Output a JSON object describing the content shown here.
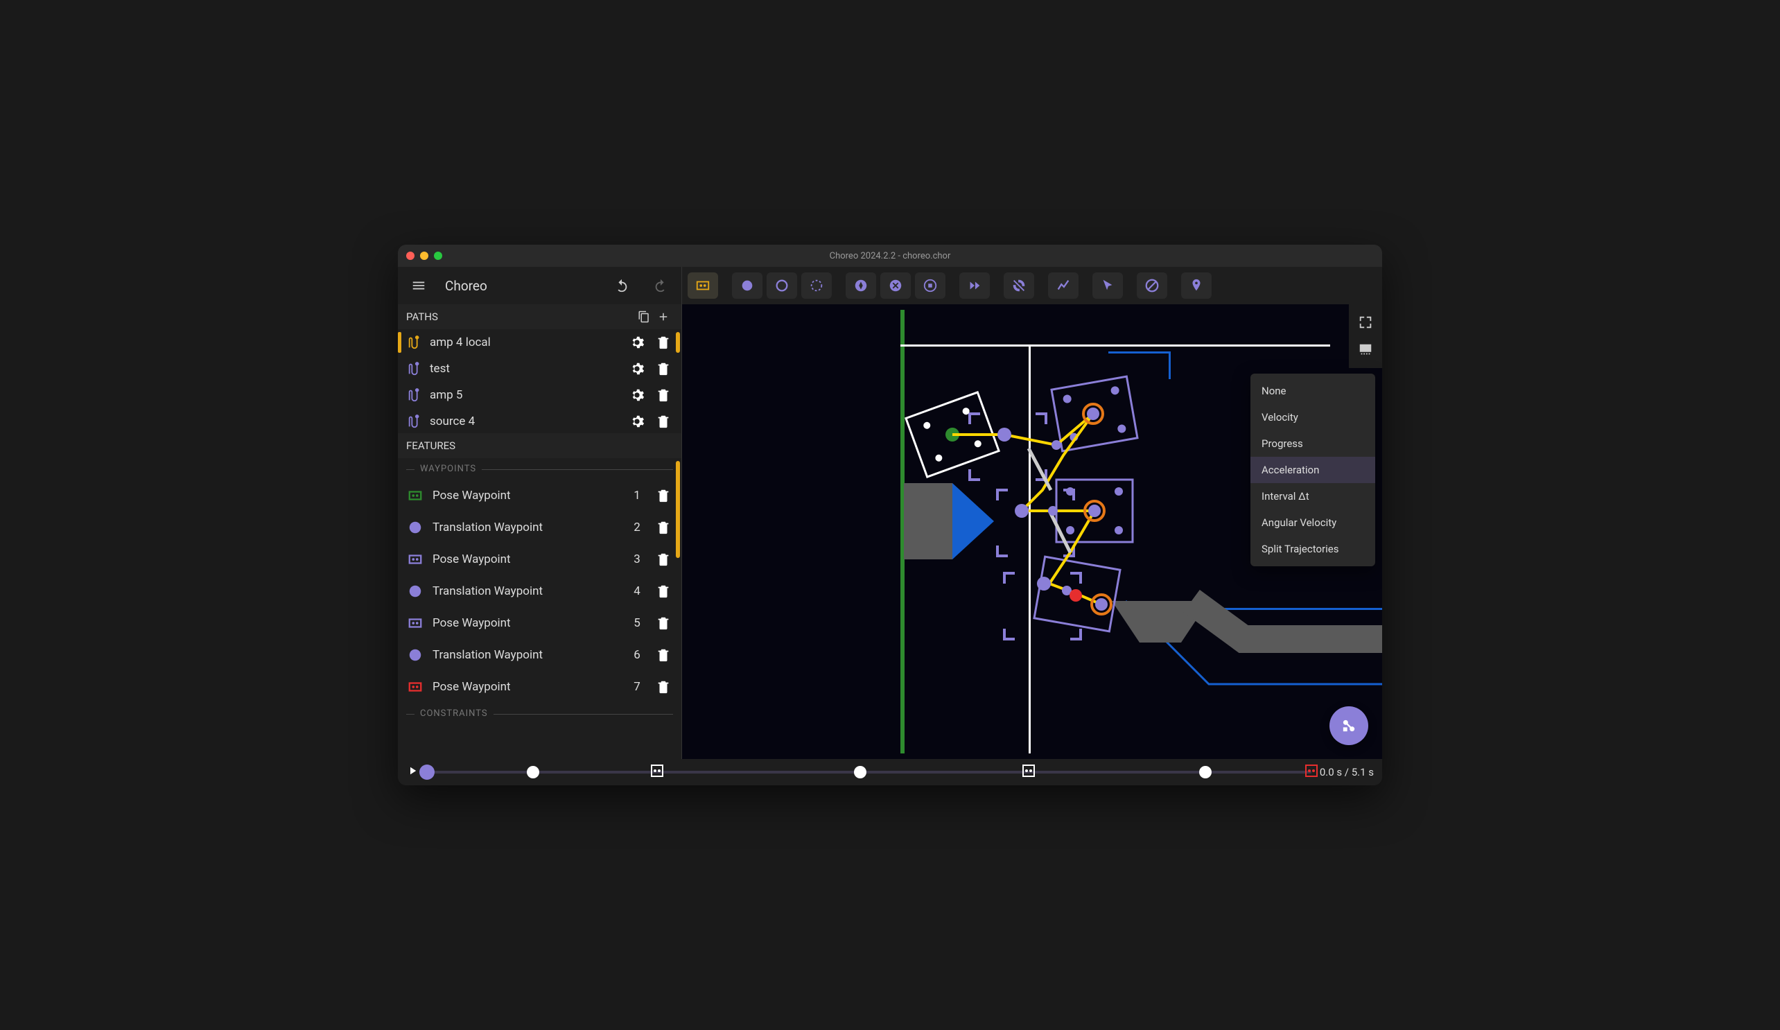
{
  "window_title": "Choreo 2024.2.2 - choreo.chor",
  "brand": "Choreo",
  "sections": {
    "paths": "PATHS",
    "features": "FEATURES",
    "waypoints": "WAYPOINTS",
    "constraints": "CONSTRAINTS"
  },
  "paths": [
    {
      "name": "amp 4 local",
      "selected": true,
      "color": "#e6a817"
    },
    {
      "name": "test",
      "selected": false,
      "color": "#8b7fd8"
    },
    {
      "name": "amp 5",
      "selected": false,
      "color": "#8b7fd8"
    },
    {
      "name": "source 4",
      "selected": false,
      "color": "#8b7fd8"
    }
  ],
  "waypoints": [
    {
      "label": "Pose Waypoint",
      "num": "1",
      "type": "pose",
      "color": "#2e8b2e"
    },
    {
      "label": "Translation Waypoint",
      "num": "2",
      "type": "translation",
      "color": "#8b7fd8"
    },
    {
      "label": "Pose Waypoint",
      "num": "3",
      "type": "pose",
      "color": "#8b7fd8"
    },
    {
      "label": "Translation Waypoint",
      "num": "4",
      "type": "translation",
      "color": "#8b7fd8"
    },
    {
      "label": "Pose Waypoint",
      "num": "5",
      "type": "pose",
      "color": "#8b7fd8"
    },
    {
      "label": "Translation Waypoint",
      "num": "6",
      "type": "translation",
      "color": "#8b7fd8"
    },
    {
      "label": "Pose Waypoint",
      "num": "7",
      "type": "pose",
      "color": "#e62e2e"
    }
  ],
  "toolbar_tools": [
    {
      "name": "selection-box",
      "active": true
    },
    {
      "name": "filled-circle"
    },
    {
      "name": "hollow-circle"
    },
    {
      "name": "rotate-circle"
    },
    {
      "name": "compass"
    },
    {
      "name": "cancel-circle"
    },
    {
      "name": "target-circle"
    },
    {
      "name": "fast-forward"
    },
    {
      "name": "sync-off"
    },
    {
      "name": "path-line"
    },
    {
      "name": "cursor-arrow"
    },
    {
      "name": "no-entry"
    },
    {
      "name": "pin-marker"
    }
  ],
  "dropdown": {
    "items": [
      "None",
      "Velocity",
      "Progress",
      "Acceleration",
      "Interval Δt",
      "Angular Velocity",
      "Split Trajectories"
    ],
    "selected": "Acceleration"
  },
  "timeline": {
    "current": "0.0 s",
    "total": "5.1 s",
    "display": "0.0 s / 5.1 s"
  },
  "colors": {
    "accent": "#8b7fd8",
    "highlight": "#e6a817",
    "bg": "#1e1e1e",
    "dark": "#050510"
  }
}
